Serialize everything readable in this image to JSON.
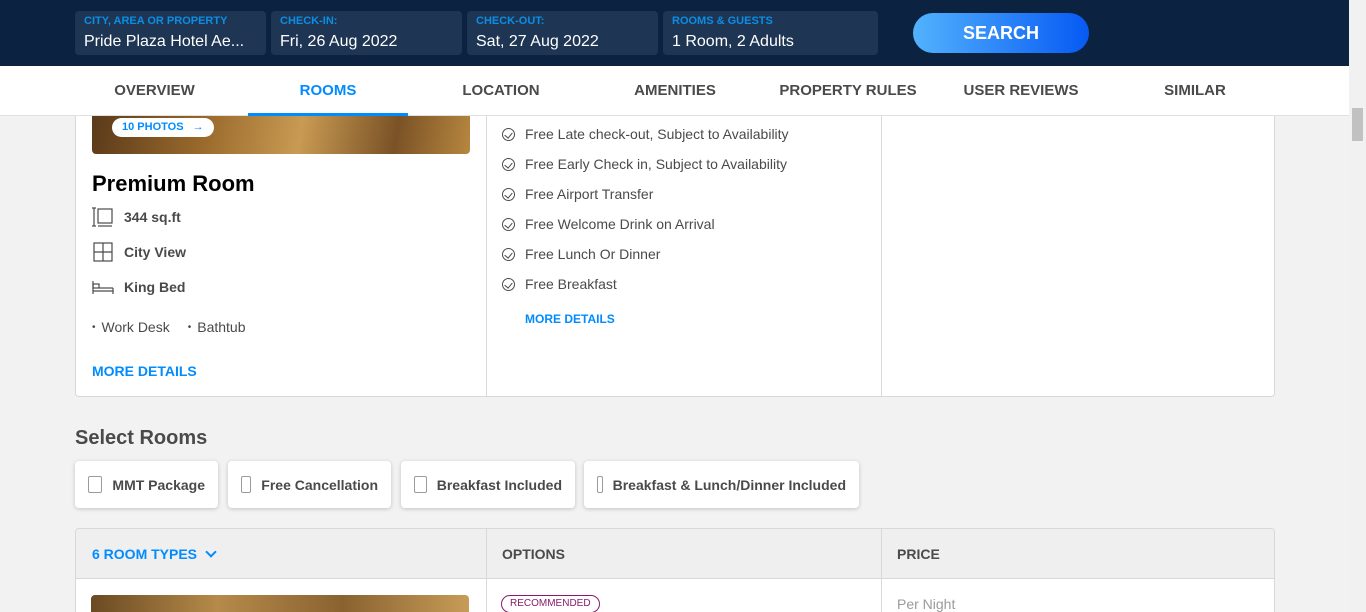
{
  "search": {
    "city": {
      "label": "CITY, AREA OR PROPERTY",
      "value": "Pride Plaza Hotel Ae..."
    },
    "checkin": {
      "label": "CHECK-IN:",
      "value": "Fri, 26 Aug 2022"
    },
    "checkout": {
      "label": "CHECK-OUT:",
      "value": "Sat, 27 Aug 2022"
    },
    "guests": {
      "label": "ROOMS & GUESTS",
      "value": "1 Room, 2 Adults"
    },
    "button": "SEARCH"
  },
  "tabs": [
    "OVERVIEW",
    "ROOMS",
    "LOCATION",
    "AMENITIES",
    "PROPERTY RULES",
    "USER REVIEWS",
    "SIMILAR PROPERTIES"
  ],
  "active_tab": "ROOMS",
  "room": {
    "photos": "10 PHOTOS",
    "title": "Premium Room",
    "size": "344 sq.ft",
    "view": "City View",
    "bed": "King Bed",
    "amenities": [
      "Work Desk",
      "Bathtub"
    ],
    "more_details": "MORE DETAILS"
  },
  "inclusions": [
    "Free Late check-out, Subject to Availability",
    "Free Early Check in, Subject to Availability",
    "Free Airport Transfer",
    "Free Welcome Drink on Arrival",
    "Free Lunch Or Dinner",
    "Free Breakfast"
  ],
  "inclusions_more": "MORE DETAILS",
  "select_rooms": {
    "title": "Select Rooms",
    "filters": [
      "MMT Package",
      "Free Cancellation",
      "Breakfast Included",
      "Breakfast & Lunch/Dinner Included"
    ]
  },
  "room_table": {
    "types": "6 ROOM TYPES",
    "options": "OPTIONS",
    "price": "PRICE",
    "badge": "RECOMMENDED",
    "per_night": "Per Night"
  },
  "colors": {
    "header_bg": "#0b2340",
    "accent": "#008cff",
    "badge": "#8a1a6b"
  }
}
